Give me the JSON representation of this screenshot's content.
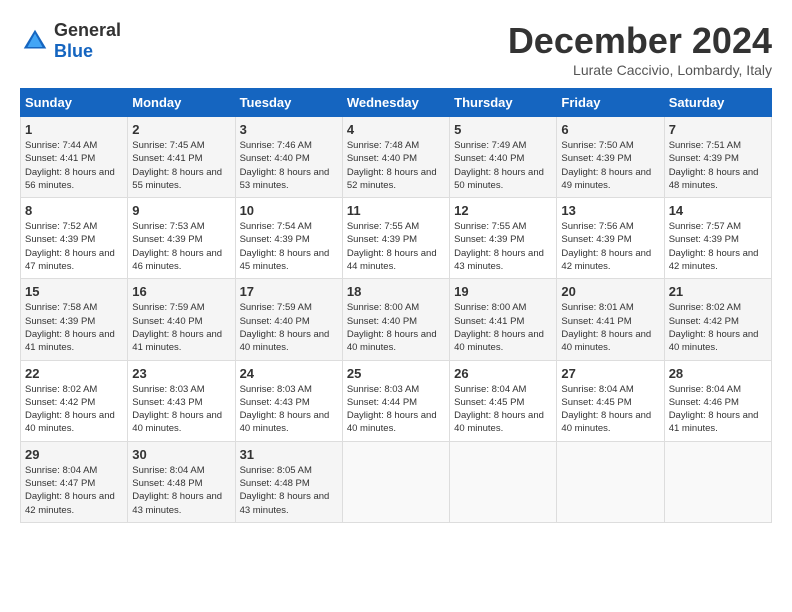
{
  "header": {
    "logo_general": "General",
    "logo_blue": "Blue",
    "title": "December 2024",
    "subtitle": "Lurate Caccivio, Lombardy, Italy"
  },
  "days_of_week": [
    "Sunday",
    "Monday",
    "Tuesday",
    "Wednesday",
    "Thursday",
    "Friday",
    "Saturday"
  ],
  "weeks": [
    [
      {
        "day": "1",
        "sunrise": "7:44 AM",
        "sunset": "4:41 PM",
        "daylight": "8 hours and 56 minutes."
      },
      {
        "day": "2",
        "sunrise": "7:45 AM",
        "sunset": "4:41 PM",
        "daylight": "8 hours and 55 minutes."
      },
      {
        "day": "3",
        "sunrise": "7:46 AM",
        "sunset": "4:40 PM",
        "daylight": "8 hours and 53 minutes."
      },
      {
        "day": "4",
        "sunrise": "7:48 AM",
        "sunset": "4:40 PM",
        "daylight": "8 hours and 52 minutes."
      },
      {
        "day": "5",
        "sunrise": "7:49 AM",
        "sunset": "4:40 PM",
        "daylight": "8 hours and 50 minutes."
      },
      {
        "day": "6",
        "sunrise": "7:50 AM",
        "sunset": "4:39 PM",
        "daylight": "8 hours and 49 minutes."
      },
      {
        "day": "7",
        "sunrise": "7:51 AM",
        "sunset": "4:39 PM",
        "daylight": "8 hours and 48 minutes."
      }
    ],
    [
      {
        "day": "8",
        "sunrise": "7:52 AM",
        "sunset": "4:39 PM",
        "daylight": "8 hours and 47 minutes."
      },
      {
        "day": "9",
        "sunrise": "7:53 AM",
        "sunset": "4:39 PM",
        "daylight": "8 hours and 46 minutes."
      },
      {
        "day": "10",
        "sunrise": "7:54 AM",
        "sunset": "4:39 PM",
        "daylight": "8 hours and 45 minutes."
      },
      {
        "day": "11",
        "sunrise": "7:55 AM",
        "sunset": "4:39 PM",
        "daylight": "8 hours and 44 minutes."
      },
      {
        "day": "12",
        "sunrise": "7:55 AM",
        "sunset": "4:39 PM",
        "daylight": "8 hours and 43 minutes."
      },
      {
        "day": "13",
        "sunrise": "7:56 AM",
        "sunset": "4:39 PM",
        "daylight": "8 hours and 42 minutes."
      },
      {
        "day": "14",
        "sunrise": "7:57 AM",
        "sunset": "4:39 PM",
        "daylight": "8 hours and 42 minutes."
      }
    ],
    [
      {
        "day": "15",
        "sunrise": "7:58 AM",
        "sunset": "4:39 PM",
        "daylight": "8 hours and 41 minutes."
      },
      {
        "day": "16",
        "sunrise": "7:59 AM",
        "sunset": "4:40 PM",
        "daylight": "8 hours and 41 minutes."
      },
      {
        "day": "17",
        "sunrise": "7:59 AM",
        "sunset": "4:40 PM",
        "daylight": "8 hours and 40 minutes."
      },
      {
        "day": "18",
        "sunrise": "8:00 AM",
        "sunset": "4:40 PM",
        "daylight": "8 hours and 40 minutes."
      },
      {
        "day": "19",
        "sunrise": "8:00 AM",
        "sunset": "4:41 PM",
        "daylight": "8 hours and 40 minutes."
      },
      {
        "day": "20",
        "sunrise": "8:01 AM",
        "sunset": "4:41 PM",
        "daylight": "8 hours and 40 minutes."
      },
      {
        "day": "21",
        "sunrise": "8:02 AM",
        "sunset": "4:42 PM",
        "daylight": "8 hours and 40 minutes."
      }
    ],
    [
      {
        "day": "22",
        "sunrise": "8:02 AM",
        "sunset": "4:42 PM",
        "daylight": "8 hours and 40 minutes."
      },
      {
        "day": "23",
        "sunrise": "8:03 AM",
        "sunset": "4:43 PM",
        "daylight": "8 hours and 40 minutes."
      },
      {
        "day": "24",
        "sunrise": "8:03 AM",
        "sunset": "4:43 PM",
        "daylight": "8 hours and 40 minutes."
      },
      {
        "day": "25",
        "sunrise": "8:03 AM",
        "sunset": "4:44 PM",
        "daylight": "8 hours and 40 minutes."
      },
      {
        "day": "26",
        "sunrise": "8:04 AM",
        "sunset": "4:45 PM",
        "daylight": "8 hours and 40 minutes."
      },
      {
        "day": "27",
        "sunrise": "8:04 AM",
        "sunset": "4:45 PM",
        "daylight": "8 hours and 40 minutes."
      },
      {
        "day": "28",
        "sunrise": "8:04 AM",
        "sunset": "4:46 PM",
        "daylight": "8 hours and 41 minutes."
      }
    ],
    [
      {
        "day": "29",
        "sunrise": "8:04 AM",
        "sunset": "4:47 PM",
        "daylight": "8 hours and 42 minutes."
      },
      {
        "day": "30",
        "sunrise": "8:04 AM",
        "sunset": "4:48 PM",
        "daylight": "8 hours and 43 minutes."
      },
      {
        "day": "31",
        "sunrise": "8:05 AM",
        "sunset": "4:48 PM",
        "daylight": "8 hours and 43 minutes."
      },
      null,
      null,
      null,
      null
    ]
  ]
}
